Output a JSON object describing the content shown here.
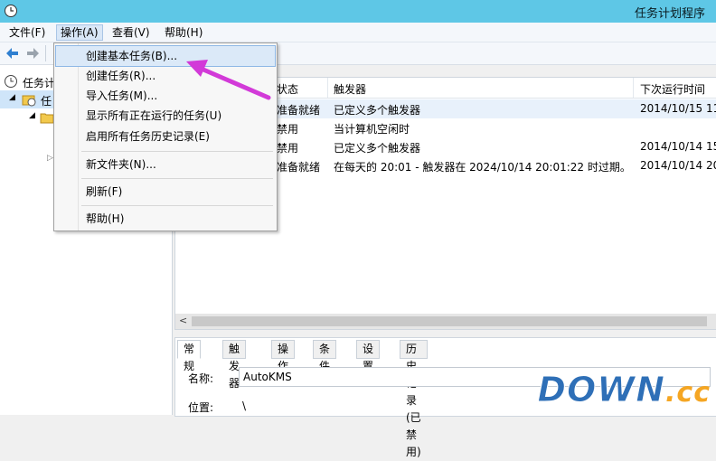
{
  "colors": {
    "titlebar": "#5ec7e6",
    "accent": "#2e6fb7",
    "arrow": "#d23ad8"
  },
  "window": {
    "title": "任务计划程序"
  },
  "menubar": {
    "items": [
      {
        "label": "文件(F)"
      },
      {
        "label": "操作(A)"
      },
      {
        "label": "查看(V)"
      },
      {
        "label": "帮助(H)"
      }
    ]
  },
  "tree": {
    "items": [
      {
        "label": "任务计划"
      },
      {
        "label": "任"
      }
    ]
  },
  "action_menu": {
    "items": [
      {
        "label": "创建基本任务(B)..."
      },
      {
        "label": "创建任务(R)..."
      },
      {
        "label": "导入任务(M)..."
      },
      {
        "label": "显示所有正在运行的任务(U)"
      },
      {
        "label": "启用所有任务历史记录(E)"
      },
      {
        "label": "新文件夹(N)..."
      },
      {
        "label": "刷新(F)"
      },
      {
        "label": "帮助(H)"
      }
    ]
  },
  "task_list": {
    "columns": [
      "状态",
      "触发器",
      "下次运行时间"
    ],
    "rows": [
      {
        "status": "准备就绪",
        "trigger": "已定义多个触发器",
        "next": "2014/10/15 11"
      },
      {
        "status": "禁用",
        "trigger": "当计算机空闲时",
        "next": ""
      },
      {
        "status": "禁用",
        "trigger": "已定义多个触发器",
        "next": "2014/10/14 15"
      },
      {
        "status": "准备就绪",
        "trigger": "在每天的 20:01 - 触发器在 2024/10/14 20:01:22 时过期。",
        "next": "2014/10/14 20"
      }
    ]
  },
  "details": {
    "tabs": [
      "常规",
      "触发器",
      "操作",
      "条件",
      "设置",
      "历史记录(已禁用)"
    ],
    "name_label": "名称:",
    "name_value": "AutoKMS",
    "location_label": "位置:",
    "location_value": "\\"
  },
  "watermark": {
    "text1": "DOWN",
    "text2": ".cc"
  }
}
